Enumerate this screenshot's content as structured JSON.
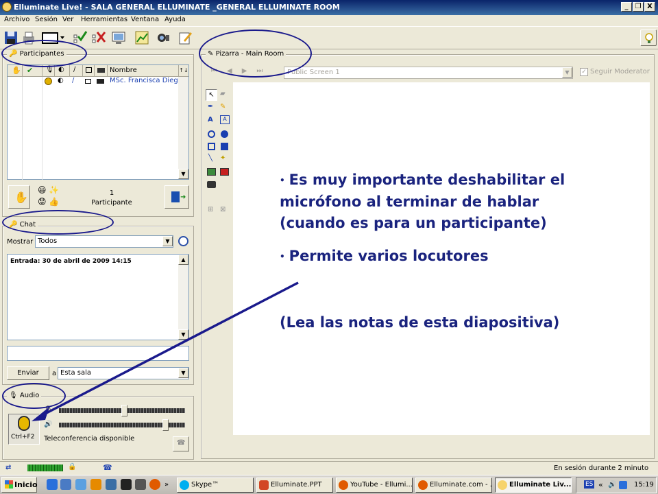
{
  "window": {
    "title": "Elluminate Live! - SALA GENERAL ELLUMINATE _GENERAL ELLUMINATE ROOM",
    "min": "_",
    "restore": "❐",
    "close": "X"
  },
  "menu": [
    "Archivo",
    "Sesión",
    "Ver",
    "Herramientas",
    "Ventana",
    "Ayuda"
  ],
  "participants": {
    "title": "Participantes",
    "col_name": "Nombre",
    "sort_glyph": "↑↓",
    "row_name": "MSc. Francisca Dieg…",
    "count": "1",
    "count_label": "Participante"
  },
  "whiteboard": {
    "title": "Pizarra - Main Room",
    "screen": "Public Screen 1",
    "follow_moderator": "Seguir Moderator",
    "bullets": [
      "Es muy importante deshabilitar el micrófono al terminar de hablar (cuando es para un participante)",
      "Permite varios locutores"
    ],
    "bullet_lines": [
      [
        "Es muy importante deshabilitar el",
        "micrófono al terminar de hablar",
        "(cuando es para un participante)"
      ],
      [
        "Permite varios locutores"
      ]
    ],
    "note": "(Lea las notas de esta diapositiva)"
  },
  "chat": {
    "title": "Chat",
    "show_label": "Mostrar",
    "show_value": "Todos",
    "entry": "Entrada: 30 de abril de 2009 14:15",
    "send": "Enviar",
    "to_label": "a",
    "to_value": "Esta sala"
  },
  "audio": {
    "title": "Audio",
    "shortcut": "Ctrl+F2",
    "status": "Teleconferencia disponible",
    "mic_level": 0.52,
    "speaker_level": 0.86
  },
  "status": {
    "session": "En sesión durante 2 minuto"
  },
  "taskbar": {
    "start": "Inicio",
    "tasks": [
      "Skype™",
      "Elluminate.PPT",
      "YouTube - Ellumi...",
      "Elluminate.com - ...",
      "Elluminate Liv..."
    ],
    "lang": "ES",
    "chevron": "«",
    "clock": "15:19"
  },
  "colors": {
    "annotation": "#1a1a8c",
    "bullet_text": "#1a237e",
    "titlebar": "#0a246a"
  }
}
